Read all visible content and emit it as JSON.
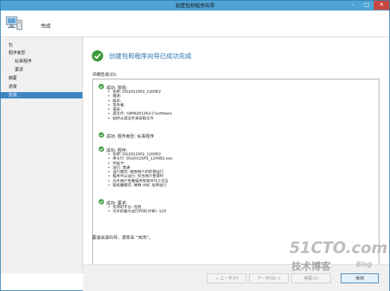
{
  "window": {
    "title": "创建包和程序向导"
  },
  "header": {
    "title": "完成"
  },
  "sidebar": {
    "items": [
      {
        "label": "包",
        "indent": false,
        "active": false
      },
      {
        "label": "程序类型",
        "indent": false,
        "active": false
      },
      {
        "label": "标准程序",
        "indent": true,
        "active": false
      },
      {
        "label": "要求",
        "indent": true,
        "active": false
      },
      {
        "label": "摘要",
        "indent": false,
        "active": false
      },
      {
        "label": "进度",
        "indent": false,
        "active": false
      },
      {
        "label": "完成",
        "indent": false,
        "active": true
      }
    ]
  },
  "main": {
    "title": "创建包和程序向导已成功完成",
    "details_label": "详细信息(D):",
    "blocks": [
      {
        "head": "成功: 常规:",
        "lines": [
          "名称: DG2012SP2_1200E2",
          "描述:",
          "版本:",
          "发布者:",
          "语言:",
          "源文件: \\\\WIN2012R2-C\\software",
          "始终从源文件夹获取文件"
        ]
      },
      {
        "head": "成功: 程序类型: 标准程序",
        "lines": []
      },
      {
        "head": "成功: 程序:",
        "lines": [
          "名称: DG2012SP2_1200E2",
          "命令行: DG2012SP2_1200E2.exe",
          "开始于:",
          "运行: 普通",
          "运行模式: 使用用户的权限运行",
          "程序可以运行: 仅当用户登录时",
          "允许用户查看程序安装并与之交互",
          "驱动器模式: 使用 UNC 名称运行"
        ]
      },
      {
        "head": "成功: 要求:",
        "lines": [
          "支持的平台: 任何",
          "允许的最大运行时间(分钟): 120"
        ]
      }
    ],
    "close_note": "要退出该向导，请单击 “关闭”。"
  },
  "footer": {
    "prev_label": "< 上一步(P)",
    "next_label": "下一步(N) >",
    "summary_label": "摘要(S)",
    "close_label": "关闭"
  },
  "watermark": {
    "line1": "51CTO.com",
    "line2": "技术博客",
    "line3": "Blog"
  },
  "colors": {
    "accent": "#3e86c2",
    "titlebar": "#4fa3d6",
    "success": "#3c9a3c",
    "title_text": "#2a6fa8"
  }
}
